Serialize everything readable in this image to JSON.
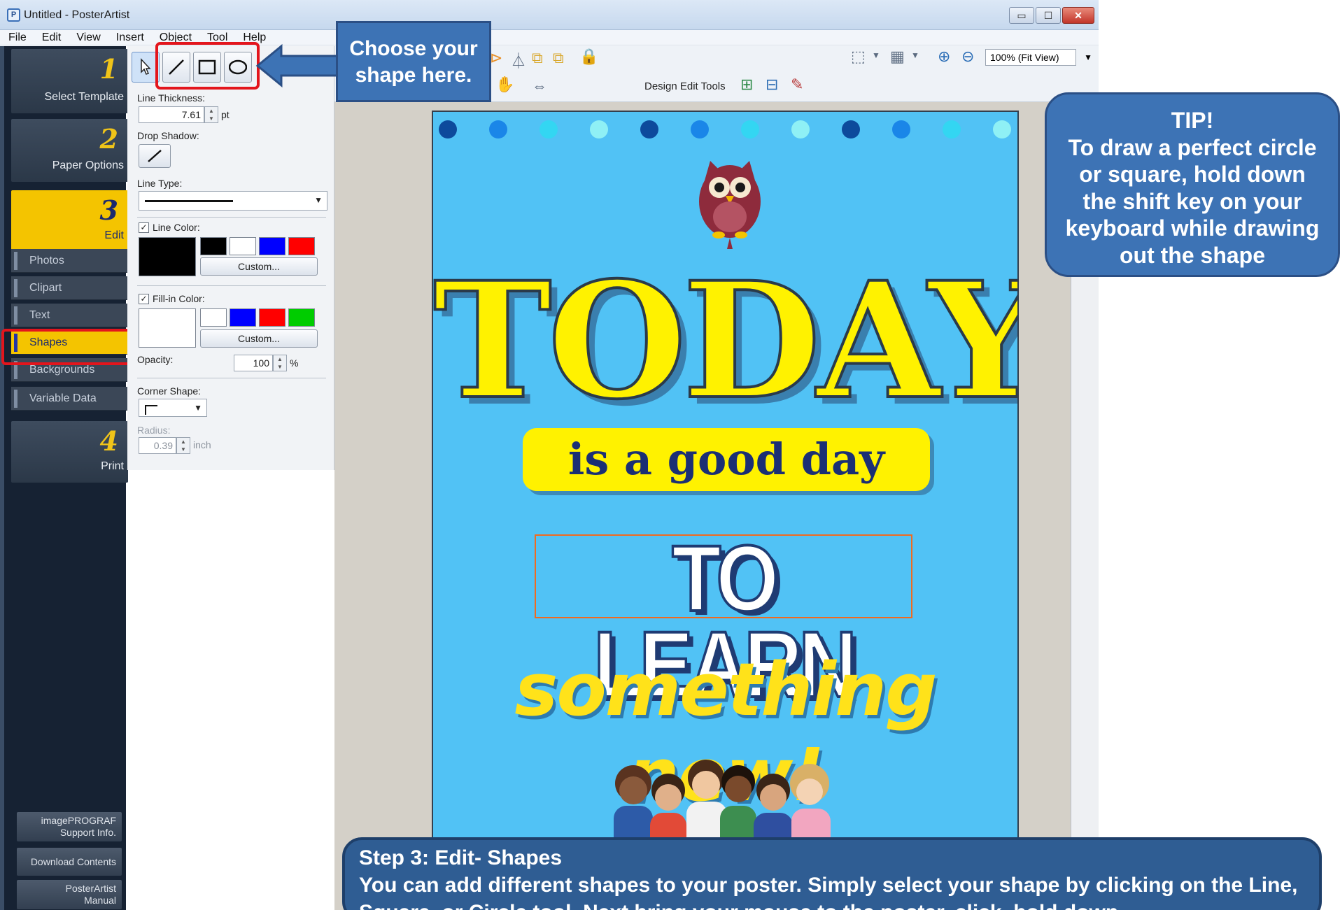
{
  "window": {
    "title": "Untitled - PosterArtist",
    "app_icon": "P",
    "controls": {
      "minimize": "▭",
      "maximize": "☐",
      "close": "✕"
    }
  },
  "menu": [
    "File",
    "Edit",
    "View",
    "Insert",
    "Object",
    "Tool",
    "Help"
  ],
  "steps": [
    {
      "num": "1",
      "label": "Select Template"
    },
    {
      "num": "2",
      "label": "Paper Options"
    },
    {
      "num": "3",
      "label": "Edit"
    },
    {
      "num": "4",
      "label": "Print"
    }
  ],
  "subnav": [
    "Photos",
    "Clipart",
    "Text",
    "Shapes",
    "Backgrounds",
    "Variable Data"
  ],
  "bottom_buttons": {
    "support": [
      "imagePROGRAF",
      "Support Info."
    ],
    "download": "Download Contents",
    "manual": [
      "PosterArtist",
      "Manual"
    ]
  },
  "panel": {
    "line_thickness_label": "Line Thickness:",
    "line_thickness_value": "7.61",
    "line_thickness_unit": "pt",
    "drop_shadow_label": "Drop Shadow:",
    "line_type_label": "Line Type:",
    "line_color_label": "Line Color:",
    "line_color_checked": "✓",
    "custom_label": "Custom...",
    "fill_color_label": "Fill-in Color:",
    "fill_color_checked": "✓",
    "opacity_label": "Opacity:",
    "opacity_value": "100",
    "opacity_unit": "%",
    "corner_shape_label": "Corner Shape:",
    "radius_label": "Radius:",
    "radius_value": "0.39",
    "radius_unit": "inch",
    "line_colors": [
      "#000000",
      "#ffffff",
      "#0000ff",
      "#ff0000"
    ],
    "line_color_current": "#000000",
    "fill_colors": [
      "#ffffff",
      "#0000ff",
      "#ff0000",
      "#00cc00"
    ],
    "fill_color_current": "#ffffff",
    "tools": [
      "select-tool",
      "line-tool",
      "rectangle-tool",
      "ellipse-tool"
    ]
  },
  "toolbar": {
    "zoom_value": "100% (Fit View)",
    "design_edit_tools": "Design Edit Tools"
  },
  "poster": {
    "background": "#51c2f5",
    "dot_colors": [
      "#0d4a9c",
      "#1a86e8",
      "#33d6f2",
      "#8ff0f5"
    ],
    "headline": "TODAY",
    "subhead": "is a good day",
    "line3": "TO LEARN",
    "line4": "something new!"
  },
  "callouts": {
    "choose_shape": [
      "Choose your",
      "shape here."
    ],
    "tip": [
      "TIP!",
      "To draw a perfect circle",
      "or square, hold down",
      "the shift key on your",
      "keyboard while drawing",
      "out the shape"
    ],
    "step3_title": "Step 3: Edit- Shapes",
    "step3_body": "You can add different shapes to your poster.  Simply select your shape by clicking on the Line, Square, or Circle tool.  Next bring your mouse to the poster, click, hold down"
  }
}
